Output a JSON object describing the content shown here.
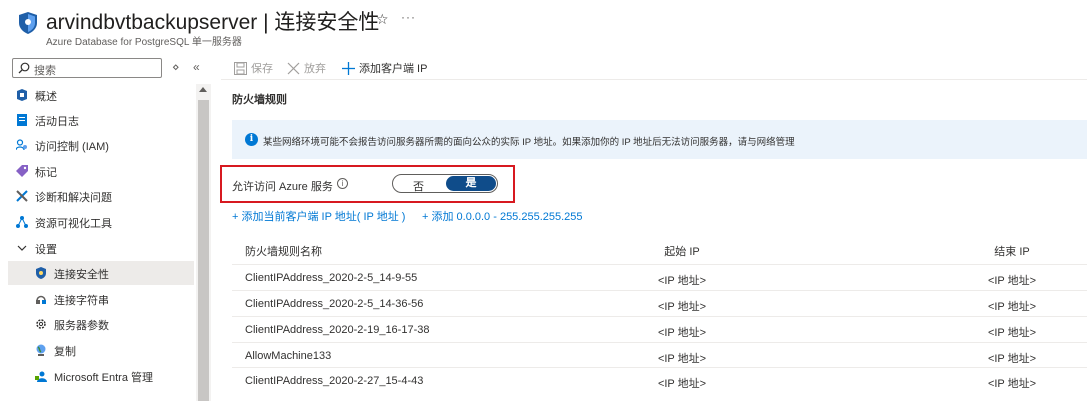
{
  "header": {
    "title": "arvindbvtbackupserver | 连接安全性",
    "subtitle": "Azure Database for PostgreSQL 单一服务器",
    "favorite_icon": "star-icon",
    "more_icon": "more-icon"
  },
  "sidebar": {
    "search_placeholder": "搜索",
    "expand_icon": "chevron-double-icon",
    "collapse_label": "«",
    "items": [
      {
        "label": "概述",
        "icon": "overview-icon"
      },
      {
        "label": "活动日志",
        "icon": "activity-log-icon"
      },
      {
        "label": "访问控制 (IAM)",
        "icon": "iam-icon"
      },
      {
        "label": "标记",
        "icon": "tag-icon"
      },
      {
        "label": "诊断和解决问题",
        "icon": "wrench-icon"
      },
      {
        "label": "资源可视化工具",
        "icon": "visualizer-icon"
      },
      {
        "label": "设置",
        "icon": "chevron-down-icon"
      },
      {
        "label": "连接安全性",
        "icon": "shield-icon",
        "selected": true
      },
      {
        "label": "连接字符串",
        "icon": "connection-string-icon"
      },
      {
        "label": "服务器参数",
        "icon": "gear-icon"
      },
      {
        "label": "复制",
        "icon": "globe-icon"
      },
      {
        "label": "Microsoft Entra 管理",
        "icon": "entra-admin-icon"
      }
    ]
  },
  "toolbar": {
    "save_label": "保存",
    "discard_label": "放弃",
    "add_client_ip_label": "添加客户端 IP"
  },
  "firewall": {
    "section_title": "防火墙规则",
    "info_text": "某些网络环境可能不会报告访问服务器所需的面向公众的实际 IP 地址。如果添加你的 IP 地址后无法访问服务器，请与网络管理",
    "allow_azure_label": "允许访问 Azure 服务",
    "toggle_off": "否",
    "toggle_on": "是",
    "toggle_value": "是",
    "add_current_link": "+ 添加当前客户端 IP 地址(  IP 地址  )",
    "add_all_link": "+ 添加 0.0.0.0 - 255.255.255.255"
  },
  "table": {
    "headers": [
      "防火墙规则名称",
      "起始 IP",
      "结束 IP"
    ],
    "rows": [
      {
        "name": "ClientIPAddress_2020-2-5_14-9-55",
        "start": "<IP 地址>",
        "end": "<IP 地址>"
      },
      {
        "name": "ClientIPAddress_2020-2-5_14-36-56",
        "start": "<IP 地址>",
        "end": "<IP 地址>"
      },
      {
        "name": "ClientIPAddress_2020-2-19_16-17-38",
        "start": "<IP 地址>",
        "end": "<IP 地址>"
      },
      {
        "name": "AllowMachine133",
        "start": "<IP 地址>",
        "end": "<IP 地址>"
      },
      {
        "name": "ClientIPAddress_2020-2-27_15-4-43",
        "start": "<IP 地址>",
        "end": "<IP 地址>"
      }
    ]
  },
  "colors": {
    "accent": "#0078d4",
    "highlight_frame": "#d71920",
    "toggle_on": "#0f4c8a"
  }
}
